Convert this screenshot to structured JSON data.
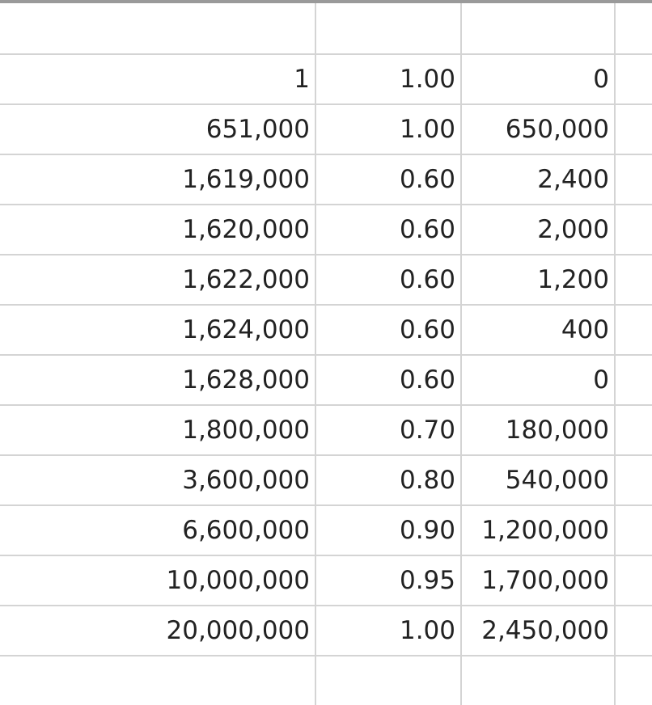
{
  "rows": [
    [
      "1",
      "1.00",
      "0"
    ],
    [
      "651,000",
      "1.00",
      "650,000"
    ],
    [
      "1,619,000",
      "0.60",
      "2,400"
    ],
    [
      "1,620,000",
      "0.60",
      "2,000"
    ],
    [
      "1,622,000",
      "0.60",
      "1,200"
    ],
    [
      "1,624,000",
      "0.60",
      "400"
    ],
    [
      "1,628,000",
      "0.60",
      "0"
    ],
    [
      "1,800,000",
      "0.70",
      "180,000"
    ],
    [
      "3,600,000",
      "0.80",
      "540,000"
    ],
    [
      "6,600,000",
      "0.90",
      "1,200,000"
    ],
    [
      "10,000,000",
      "0.95",
      "1,700,000"
    ],
    [
      "20,000,000",
      "1.00",
      "2,450,000"
    ]
  ]
}
